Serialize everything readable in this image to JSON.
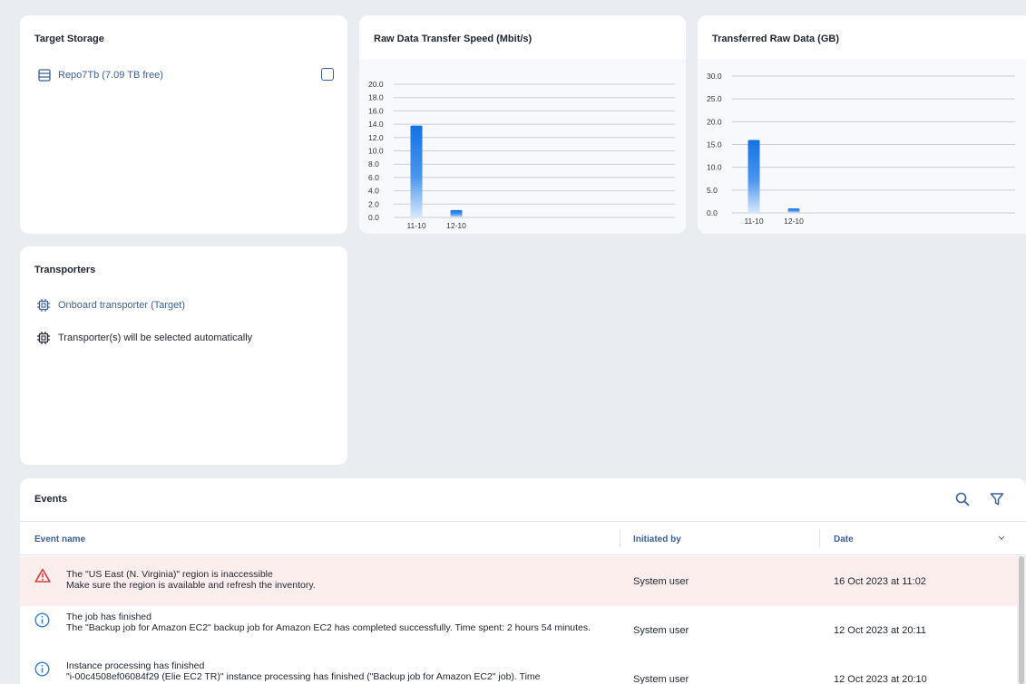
{
  "target_storage": {
    "title": "Target Storage",
    "item_label": "Repo7Tb (7.09 TB free)"
  },
  "speed_chart": {
    "title": "Raw Data Transfer Speed (Mbit/s)"
  },
  "data_chart": {
    "title": "Transferred Raw Data (GB)"
  },
  "chart_data": [
    {
      "type": "bar",
      "title": "Raw Data Transfer Speed (Mbit/s)",
      "categories": [
        "11-10",
        "12-10"
      ],
      "values": [
        13.8,
        1.1
      ],
      "ylim": [
        0,
        20
      ],
      "yticks": [
        "20.0",
        "18.0",
        "16.0",
        "14.0",
        "12.0",
        "10.0",
        "8.0",
        "6.0",
        "4.0",
        "2.0",
        "0.0"
      ],
      "grid": true
    },
    {
      "type": "bar",
      "title": "Transferred Raw Data (GB)",
      "categories": [
        "11-10",
        "12-10"
      ],
      "values": [
        16.0,
        1.0
      ],
      "ylim": [
        0,
        30
      ],
      "yticks": [
        "30.0",
        "25.0",
        "20.0",
        "15.0",
        "10.0",
        "5.0",
        "0.0"
      ],
      "grid": true
    }
  ],
  "transporters": {
    "title": "Transporters",
    "items": [
      {
        "label": "Onboard transporter (Target)"
      },
      {
        "label": "Transporter(s) will be selected automatically"
      }
    ]
  },
  "events": {
    "title": "Events",
    "columns": {
      "name": "Event name",
      "initiated": "Initiated by",
      "date": "Date"
    },
    "rows": [
      {
        "icon": "warning-icon",
        "title": "The \"US East (N. Virginia)\" region is inaccessible",
        "detail": "Make sure the region is available and refresh the inventory.",
        "initiated_by": "System user",
        "date": "16 Oct 2023 at 11:02"
      },
      {
        "icon": "info-icon",
        "title": "The job has finished",
        "detail": "The \"Backup job for Amazon EC2\" backup job for Amazon EC2 has completed successfully. Time spent: 2 hours 54 minutes.",
        "initiated_by": "System user",
        "date": "12 Oct 2023 at 20:11"
      },
      {
        "icon": "info-icon",
        "title": "Instance processing has finished",
        "detail": "\"i-00c4508ef06084f29 (Elie EC2 TR)\" instance processing has finished (\"Backup job for Amazon EC2\" job). Time",
        "initiated_by": "System user",
        "date": "12 Oct 2023 at 20:10"
      }
    ]
  },
  "colors": {
    "accent": "#1273e6",
    "link": "#3b5f99",
    "warning_row": "#fdeeee",
    "warning_icon": "#d93a3a",
    "info_icon": "#2f7fe0"
  }
}
